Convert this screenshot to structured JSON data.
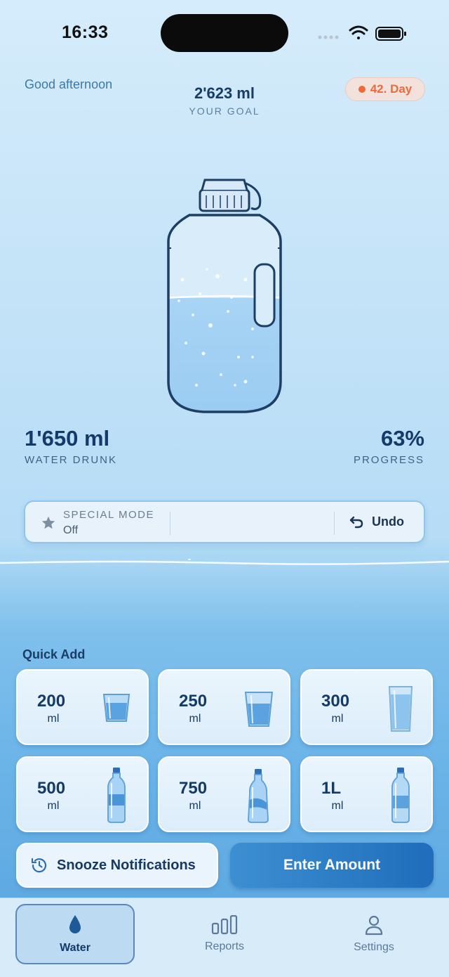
{
  "status": {
    "time": "16:33"
  },
  "header": {
    "greeting": "Good afternoon",
    "goal_value": "2'623 ml",
    "goal_label": "YOUR GOAL",
    "day_badge": "42. Day"
  },
  "stats": {
    "drunk_value": "1'650 ml",
    "drunk_label": "WATER DRUNK",
    "progress_value": "63%",
    "progress_label": "PROGRESS",
    "progress_fraction": 0.63
  },
  "mode_bar": {
    "title": "SPECIAL MODE",
    "value": "Off",
    "undo_label": "Undo"
  },
  "quick_add": {
    "title": "Quick Add",
    "items": [
      {
        "amount": "200",
        "unit": "ml",
        "icon": "small-glass-icon"
      },
      {
        "amount": "250",
        "unit": "ml",
        "icon": "glass-icon"
      },
      {
        "amount": "300",
        "unit": "ml",
        "icon": "tall-glass-icon"
      },
      {
        "amount": "500",
        "unit": "ml",
        "icon": "bottle-icon"
      },
      {
        "amount": "750",
        "unit": "ml",
        "icon": "large-bottle-icon"
      },
      {
        "amount": "1L",
        "unit": "ml",
        "icon": "liter-bottle-icon"
      }
    ]
  },
  "actions": {
    "snooze_label": "Snooze Notifications",
    "enter_label": "Enter Amount"
  },
  "tabs": [
    {
      "label": "Water",
      "icon": "water-drop-icon",
      "active": true
    },
    {
      "label": "Reports",
      "icon": "bar-chart-icon",
      "active": false
    },
    {
      "label": "Settings",
      "icon": "person-icon",
      "active": false
    }
  ],
  "colors": {
    "accent": "#1f6dbb",
    "badge": "#ef6a3a",
    "text_dark": "#143a6b"
  }
}
